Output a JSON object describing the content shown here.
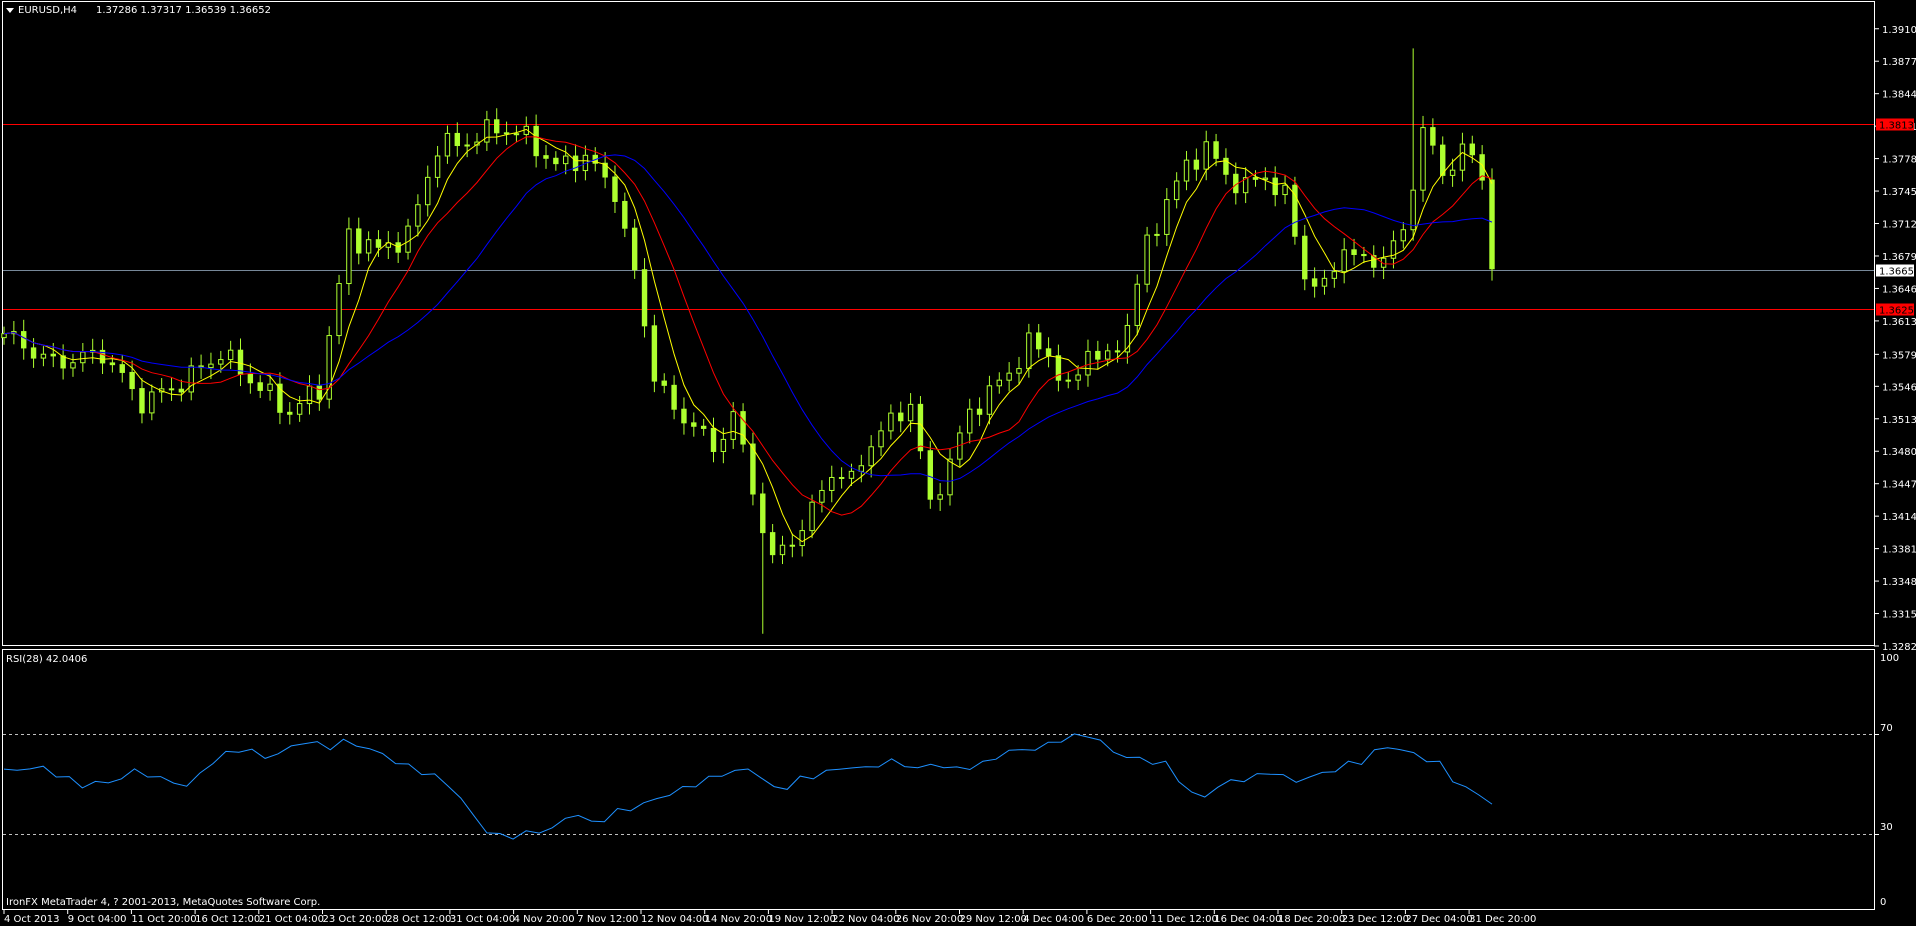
{
  "header": {
    "symbol_label": "EURUSD,H4",
    "ohlc": "1.37286 1.37317 1.36539 1.36652"
  },
  "footer": {
    "copyright": "IronFX MetaTrader 4, ? 2001-2013, MetaQuotes Software Corp."
  },
  "rsi": {
    "label": "RSI(28) 42.0406",
    "levels": [
      100,
      70,
      30,
      0
    ],
    "level_labels": [
      "100",
      "70",
      "30",
      "0"
    ]
  },
  "colors": {
    "background": "#000000",
    "frame": "#ffffff",
    "candle": "#adff2f",
    "ma_fast": "#ffff00",
    "ma_mid": "#ff0000",
    "ma_slow": "#0000ff",
    "rsi_line": "#1e90ff",
    "hline_red": "#ff0000",
    "hline_price": "#778899",
    "badge_red": "#ff0000"
  },
  "chart_data": [
    {
      "type": "candlestick",
      "ylim": [
        1.32825,
        1.3925
      ],
      "y_ticks": [
        "1.39100",
        "1.38770",
        "1.38440",
        "1.38110",
        "1.37780",
        "1.37450",
        "1.37120",
        "1.36790",
        "1.36460",
        "1.36130",
        "1.35790",
        "1.35465",
        "1.35135",
        "1.34805",
        "1.34475",
        "1.34145",
        "1.33815",
        "1.33485",
        "1.33155",
        "1.32825"
      ],
      "x_tick_labels": [
        "4 Oct 2013",
        "9 Oct 04:00",
        "11 Oct 20:00",
        "16 Oct 12:00",
        "21 Oct 04:00",
        "23 Oct 20:00",
        "28 Oct 12:00",
        "31 Oct 04:00",
        "4 Nov 20:00",
        "7 Nov 12:00",
        "12 Nov 04:00",
        "14 Nov 20:00",
        "19 Nov 12:00",
        "22 Nov 04:00",
        "26 Nov 20:00",
        "29 Nov 12:00",
        "4 Dec 04:00",
        "6 Dec 20:00",
        "11 Dec 12:00",
        "16 Dec 04:00",
        "18 Dec 20:00",
        "23 Dec 12:00",
        "27 Dec 04:00",
        "31 Dec 20:00"
      ],
      "horizontal_lines": [
        {
          "price": 1.3813,
          "label": "1.38130",
          "style": "red"
        },
        {
          "price": 1.36652,
          "label": "1.36652",
          "style": "price"
        },
        {
          "price": 1.3625,
          "label": "1.36250",
          "style": "red"
        }
      ],
      "price_anchors": [
        [
          0,
          1.36
        ],
        [
          5,
          1.357
        ],
        [
          10,
          1.358
        ],
        [
          14,
          1.353
        ],
        [
          18,
          1.355
        ],
        [
          22,
          1.358
        ],
        [
          26,
          1.3545
        ],
        [
          29,
          1.352
        ],
        [
          32,
          1.3545
        ],
        [
          35,
          1.37
        ],
        [
          38,
          1.3685
        ],
        [
          41,
          1.37
        ],
        [
          44,
          1.379
        ],
        [
          47,
          1.3795
        ],
        [
          50,
          1.381
        ],
        [
          53,
          1.38
        ],
        [
          56,
          1.377
        ],
        [
          59,
          1.378
        ],
        [
          62,
          1.3745
        ],
        [
          64,
          1.366
        ],
        [
          66,
          1.356
        ],
        [
          68,
          1.352
        ],
        [
          70,
          1.351
        ],
        [
          72,
          1.348
        ],
        [
          74,
          1.352
        ],
        [
          76,
          1.344
        ],
        [
          78,
          1.337
        ],
        [
          80,
          1.339
        ],
        [
          82,
          1.342
        ],
        [
          84,
          1.346
        ],
        [
          86,
          1.345
        ],
        [
          88,
          1.349
        ],
        [
          90,
          1.351
        ],
        [
          92,
          1.353
        ],
        [
          94,
          1.3425
        ],
        [
          96,
          1.347
        ],
        [
          98,
          1.352
        ],
        [
          100,
          1.354
        ],
        [
          102,
          1.356
        ],
        [
          104,
          1.359
        ],
        [
          106,
          1.358
        ],
        [
          108,
          1.354
        ],
        [
          110,
          1.3585
        ],
        [
          112,
          1.357
        ],
        [
          114,
          1.361
        ],
        [
          116,
          1.369
        ],
        [
          118,
          1.3735
        ],
        [
          120,
          1.377
        ],
        [
          122,
          1.379
        ],
        [
          124,
          1.376
        ],
        [
          126,
          1.375
        ],
        [
          128,
          1.376
        ],
        [
          130,
          1.374
        ],
        [
          132,
          1.366
        ],
        [
          134,
          1.3645
        ],
        [
          136,
          1.369
        ],
        [
          138,
          1.367
        ],
        [
          140,
          1.368
        ],
        [
          142,
          1.37
        ],
        [
          144,
          1.381
        ],
        [
          146,
          1.376
        ],
        [
          148,
          1.379
        ],
        [
          150,
          1.376
        ],
        [
          151,
          1.3666
        ]
      ],
      "spikes": [
        {
          "bar": 77,
          "low": 1.3295
        },
        {
          "bar": 143,
          "high": 1.389
        },
        {
          "bar": 151,
          "low": 1.3654
        }
      ],
      "moving_averages": [
        {
          "period": 5,
          "style": "ma_fast"
        },
        {
          "period": 10,
          "style": "ma_mid"
        },
        {
          "period": 21,
          "style": "ma_slow"
        }
      ]
    },
    {
      "type": "line",
      "ylim": [
        0,
        100
      ],
      "y_ticks": [
        100,
        70,
        30,
        0
      ],
      "series": [
        {
          "name": "RSI(28)",
          "values": [
            56,
            55,
            57,
            56,
            54,
            52,
            49,
            51,
            50,
            53,
            55,
            54,
            52,
            51,
            49,
            54,
            59,
            62,
            64,
            63,
            61,
            62,
            65,
            67,
            66,
            65,
            67,
            66,
            64,
            62,
            59,
            57,
            55,
            53,
            50,
            44,
            37,
            31,
            29,
            29,
            30,
            31,
            32,
            36,
            38,
            34,
            36,
            39,
            40,
            42,
            44,
            46,
            48,
            50,
            52,
            54,
            55,
            56,
            53,
            48,
            49,
            52,
            53,
            55,
            56,
            57,
            56,
            58,
            59,
            58,
            56,
            58,
            57,
            56,
            57,
            58,
            61,
            63,
            64,
            64,
            66,
            68,
            69,
            70,
            67,
            63,
            61,
            60,
            59,
            58,
            52,
            46,
            45,
            49,
            51,
            52,
            53,
            55,
            53,
            51,
            53,
            54,
            56,
            58,
            59,
            63,
            65,
            64,
            62,
            60,
            58,
            52,
            48,
            46,
            42
          ]
        }
      ]
    }
  ]
}
